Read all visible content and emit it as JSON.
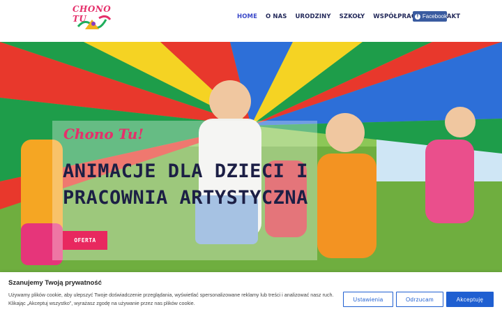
{
  "brand": {
    "logo_text": "CHONO TU"
  },
  "nav": {
    "items": [
      {
        "label": "HOME",
        "active": true
      },
      {
        "label": "O NAS"
      },
      {
        "label": "URODZINY"
      },
      {
        "label": "SZKOŁY"
      },
      {
        "label": "WSPÓŁPRACA"
      },
      {
        "label": "KONTAKT"
      }
    ],
    "facebook_label": "Facebook"
  },
  "hero": {
    "subtitle": "Chono Tu!",
    "title_line1": "ANIMACJE DLA DZIECI I",
    "title_line2": "PRACOWNIA ARTYSTYCZNA",
    "cta_label": "OFERTA"
  },
  "cookie": {
    "title": "Szanujemy Twoją prywatność",
    "text": "Używamy plików cookie, aby ulepszyć Twoje doświadczenie przeglądania, wyświetlać spersonalizowane reklamy lub treści i analizować nasz ruch. Klikając „Akceptuj wszystko”, wyrażasz zgodę na używanie przez nas plików cookie.",
    "buttons": {
      "settings": "Ustawienia",
      "reject": "Odrzucam",
      "accept": "Akceptuję"
    }
  },
  "colors": {
    "accent": "#e8285f",
    "nav_active": "#3b49c9",
    "nav": "#23295a",
    "cookie_blue": "#1f5fd1",
    "facebook": "#3a5ba0"
  }
}
